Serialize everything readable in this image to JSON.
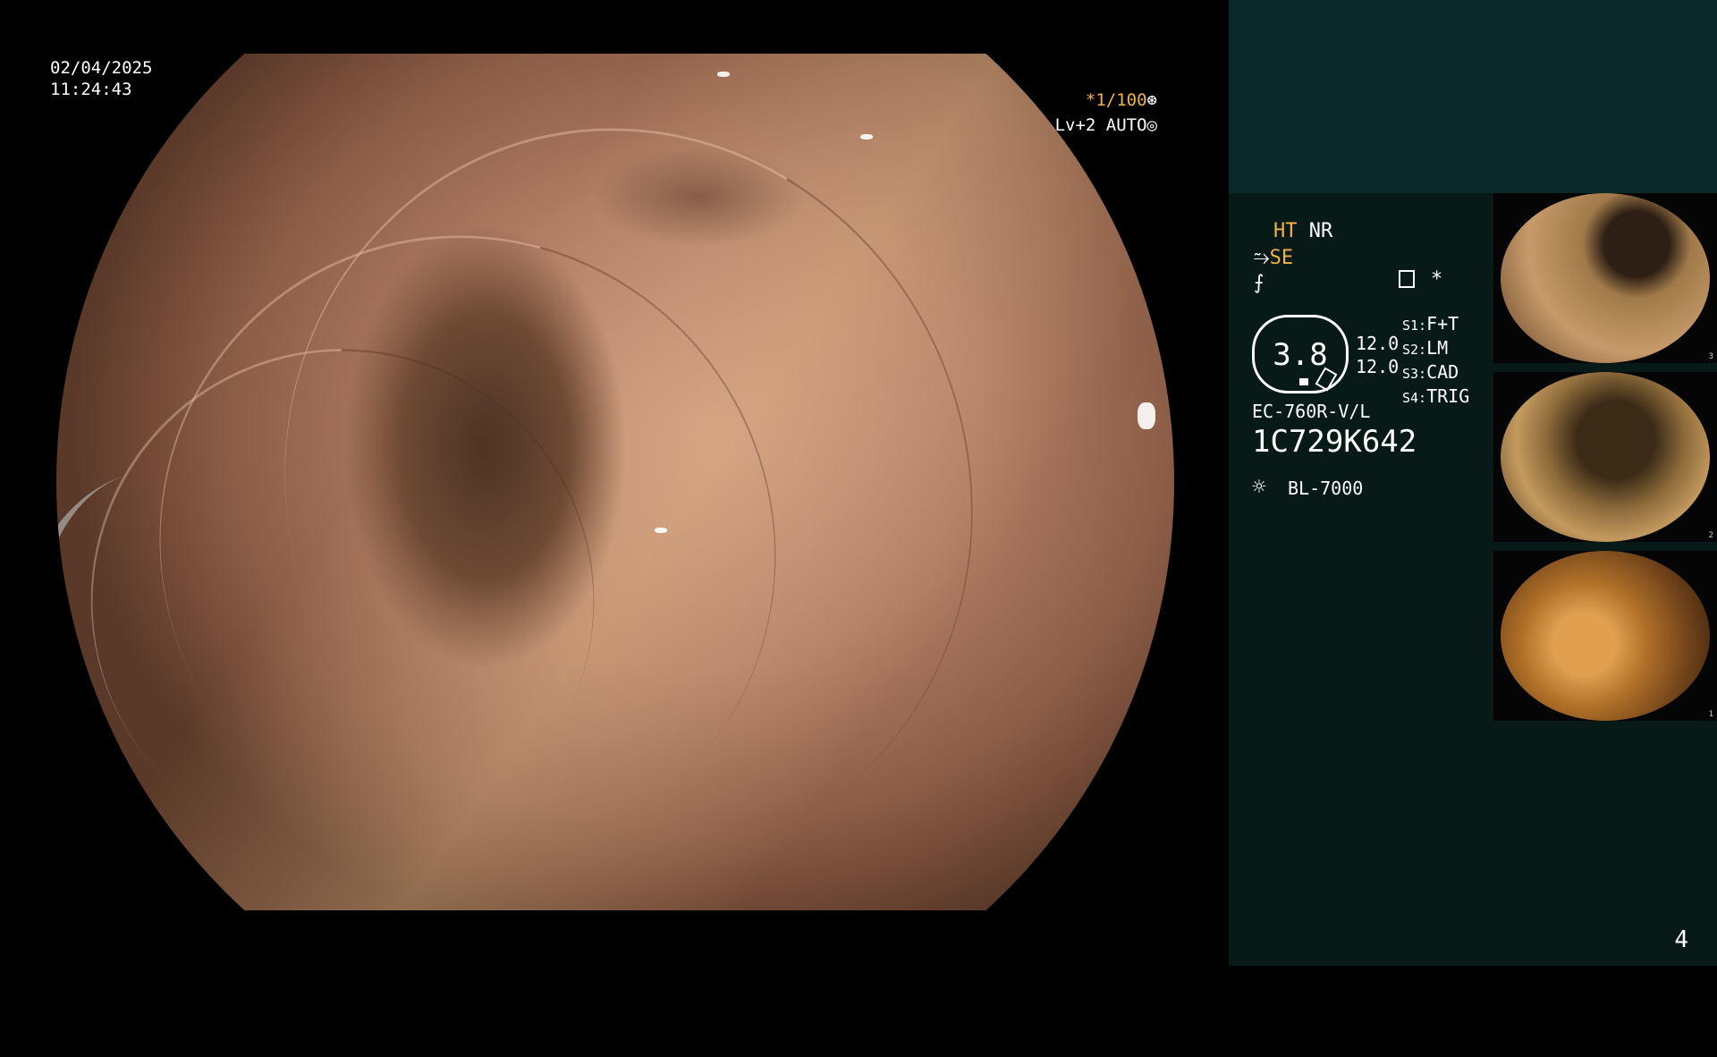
{
  "overlay": {
    "date": "02/04/2025",
    "time": "11:24:43",
    "shutter": "*1/100",
    "shutter_icon": "⊛",
    "level_mode": "Lv+2 AUTO",
    "level_icon": "◎"
  },
  "panel": {
    "mode_ht": "HT",
    "mode_nr": "NR",
    "se_icon": "⥲",
    "mode_se": "SE",
    "icon_row3": "⨍",
    "star_icon": "*",
    "dial_value": "3.8",
    "value_1": "12.0",
    "value_2": "12.0",
    "switches": [
      {
        "key": "S1:",
        "value": "F+T"
      },
      {
        "key": "S2:",
        "value": "LM"
      },
      {
        "key": "S3:",
        "value": "CAD"
      },
      {
        "key": "S4:",
        "value": "TRIG"
      }
    ],
    "scope_model": "EC-760R-V/L",
    "scope_serial": "1C729K642",
    "light_icon": "☼",
    "light_source": "BL-7000"
  },
  "thumbnails": [
    {
      "num": "3"
    },
    {
      "num": "2"
    },
    {
      "num": "1"
    }
  ],
  "page_number": "4",
  "colors": {
    "accent": "#f2b24a",
    "panel_bg": "#071a18",
    "panel_top_bg": "#0a2a27"
  }
}
